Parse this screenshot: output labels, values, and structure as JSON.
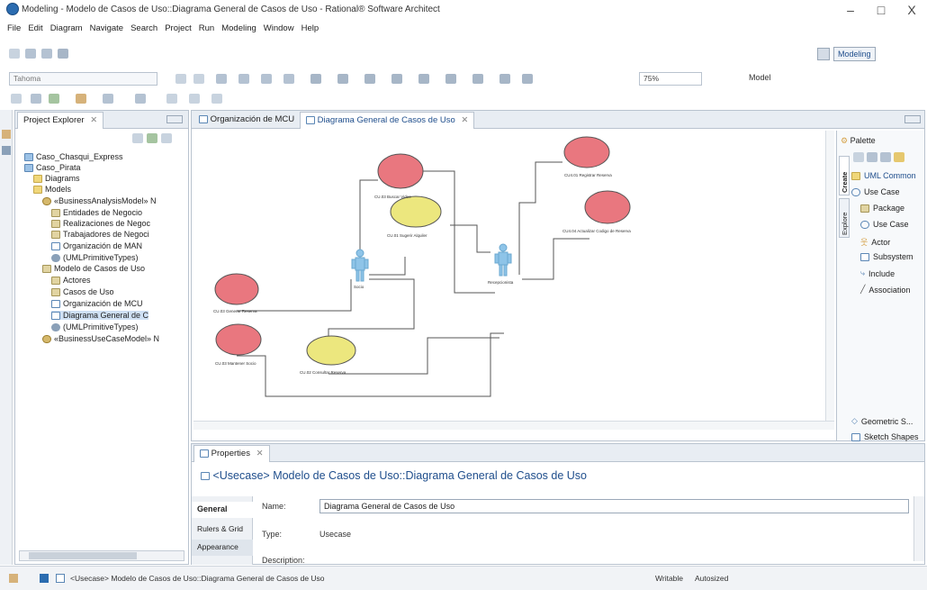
{
  "window": {
    "title": "Modeling - Modelo de Casos de Uso::Diagrama General de Casos de Uso - Rational® Software Architect",
    "minimize": "–",
    "maximize": "□",
    "close": "X"
  },
  "menu": [
    "File",
    "Edit",
    "Diagram",
    "Navigate",
    "Search",
    "Project",
    "Run",
    "Modeling",
    "Window",
    "Help"
  ],
  "toolbar": {
    "font": "Tahoma",
    "zoom": "75%",
    "model_button": "Model",
    "perspective": "Modeling"
  },
  "project_explorer": {
    "title": "Project Explorer",
    "tab_close": "✕",
    "items": [
      {
        "label": "Caso_Chasqui_Express",
        "icon": "proj"
      },
      {
        "label": "Caso_Pirata",
        "icon": "proj"
      },
      {
        "label": "Diagrams",
        "icon": "folder"
      },
      {
        "label": "Models",
        "icon": "folder"
      },
      {
        "label": "«BusinessAnalysisModel» N",
        "icon": "model"
      },
      {
        "label": "Entidades de Negocio",
        "icon": "pkg"
      },
      {
        "label": "Realizaciones de Negoc",
        "icon": "pkg"
      },
      {
        "label": "Trabajadores de Negoci",
        "icon": "pkg"
      },
      {
        "label": "Organización de MAN",
        "icon": "diag"
      },
      {
        "label": "(UMLPrimitiveTypes)",
        "icon": "gear"
      },
      {
        "label": "Modelo de Casos de Uso",
        "icon": "pkg"
      },
      {
        "label": "Actores",
        "icon": "pkg"
      },
      {
        "label": "Casos de Uso",
        "icon": "pkg"
      },
      {
        "label": "Organización de MCU",
        "icon": "diag"
      },
      {
        "label": "Diagrama General de C",
        "icon": "diag"
      },
      {
        "label": "(UMLPrimitiveTypes)",
        "icon": "gear"
      },
      {
        "label": "«BusinessUseCaseModel» N",
        "icon": "model"
      }
    ]
  },
  "editor_tabs": [
    {
      "label": "Organización de MCU",
      "active": false
    },
    {
      "label": "Diagrama General de Casos de Uso",
      "active": true
    }
  ],
  "diagram": {
    "use_cases": [
      {
        "label": "CU.03 Buscar Video",
        "color": "#e9777f"
      },
      {
        "label": "CU.01 Sugerir Alquiler",
        "color": "#ece77e"
      },
      {
        "label": "CU.03 Generar Reserva",
        "color": "#e9777f"
      },
      {
        "label": "CU.03 Mantener Socio",
        "color": "#e9777f"
      },
      {
        "label": "CU.02 Consultar Reserva",
        "color": "#ece77e"
      },
      {
        "label": "CU4.01 Registrar Reserva",
        "color": "#e9777f"
      },
      {
        "label": "CU4.04 Actualizar Codigo de Reserva",
        "color": "#e9777f"
      }
    ],
    "actors": [
      {
        "label": "Socio"
      },
      {
        "label": "Recepcionista"
      }
    ]
  },
  "palette": {
    "title": "Palette",
    "vtab_create": "Create",
    "vtab_explore": "Explore",
    "drawer": "UML Common",
    "group": "Use Case",
    "items": [
      "Package",
      "Use Case",
      "Actor",
      "Subsystem",
      "Include",
      "Association"
    ],
    "bottom": [
      "Geometric S...",
      "Sketch Shapes"
    ]
  },
  "properties": {
    "tab": "Properties",
    "header": "<Usecase> Modelo de Casos de Uso::Diagrama General de Casos de Uso",
    "sections": [
      "General",
      "Rulers & Grid",
      "Appearance"
    ],
    "name_label": "Name:",
    "name_value": "Diagrama General de Casos de Uso",
    "type_label": "Type:",
    "type_value": "Usecase",
    "description_label": "Description:"
  },
  "status": {
    "text": "<Usecase> Modelo de Casos de Uso::Diagrama General de Casos de Uso",
    "writable": "Writable",
    "autosized": "Autosized"
  },
  "colors": {
    "usecase_red": "#e9777f",
    "usecase_yellow": "#ece77e",
    "actor_blue": "#8ec4e8",
    "header_blue": "#1f4e8c"
  }
}
